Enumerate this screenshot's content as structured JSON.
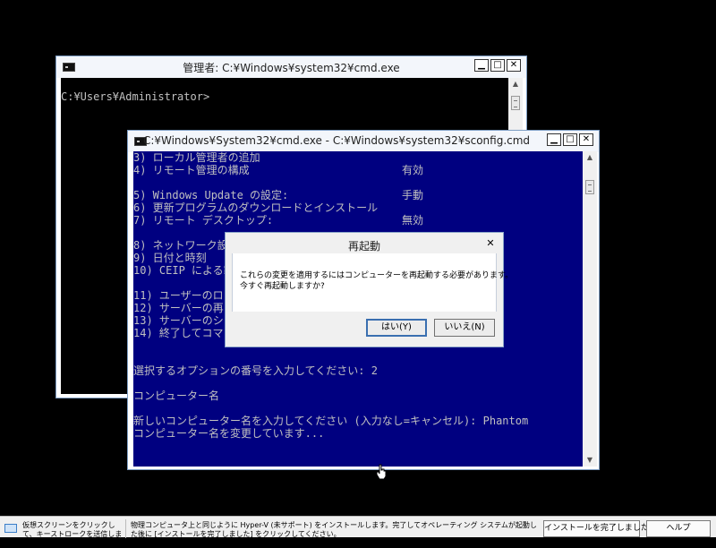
{
  "back_window": {
    "title": "管理者: C:¥Windows¥system32¥cmd.exe",
    "prompt": "C:¥Users¥Administrator>"
  },
  "window_controls": {
    "minimize": "▁",
    "maximize": "□",
    "close": "✕"
  },
  "front_window": {
    "title": "C:¥Windows¥System32¥cmd.exe - C:¥Windows¥system32¥sconfig.cmd",
    "menu": [
      {
        "label": "3) ローカル管理者の追加",
        "value": ""
      },
      {
        "label": "4) リモート管理の構成",
        "value": "有効"
      },
      {
        "label": "",
        "value": ""
      },
      {
        "label": "5) Windows Update の設定:",
        "value": "手動"
      },
      {
        "label": "6) 更新プログラムのダウンロードとインストール",
        "value": ""
      },
      {
        "label": "7) リモート デスクトップ:",
        "value": "無効"
      },
      {
        "label": "",
        "value": ""
      },
      {
        "label": "8) ネットワーク設",
        "value": ""
      },
      {
        "label": "9) 日付と時刻",
        "value": ""
      },
      {
        "label": "10) CEIP による製",
        "value": ""
      },
      {
        "label": "",
        "value": ""
      },
      {
        "label": "11) ユーザーのロ",
        "value": ""
      },
      {
        "label": "12) サーバーの再",
        "value": ""
      },
      {
        "label": "13) サーバーのシ",
        "value": ""
      },
      {
        "label": "14) 終了してコマ",
        "value": ""
      }
    ],
    "output": [
      "",
      "",
      "選択するオプションの番号を入力してください: 2",
      "",
      "コンピューター名",
      "",
      "新しいコンピューター名を入力してください (入力なし=キャンセル): Phantom",
      "コンピューター名を変更しています..."
    ]
  },
  "dialog": {
    "title": "再起動",
    "close": "✕",
    "message_line1": "これらの変更を適用するにはコンピューターを再起動する必要があります。",
    "message_line2": "今すぐ再起動しますか?",
    "yes_label": "はい(Y)",
    "no_label": "いいえ(N)"
  },
  "taskbar": {
    "hint": "仮想スクリーンをクリックして、キーストロークを送信します",
    "message": "物理コンピュータ上と同じように Hyper-V (未サポート) をインストールします。完了してオペレーティング システムが起動した後に [インストールを完了しました] をクリックしてください。",
    "finish_button": "インストールを完了しました",
    "help_button": "ヘルプ"
  },
  "colors": {
    "console_back": "#000000",
    "console_front": "#000080",
    "console_text": "#c0c0c0",
    "dialog_default_border": "#3a6fb0"
  }
}
